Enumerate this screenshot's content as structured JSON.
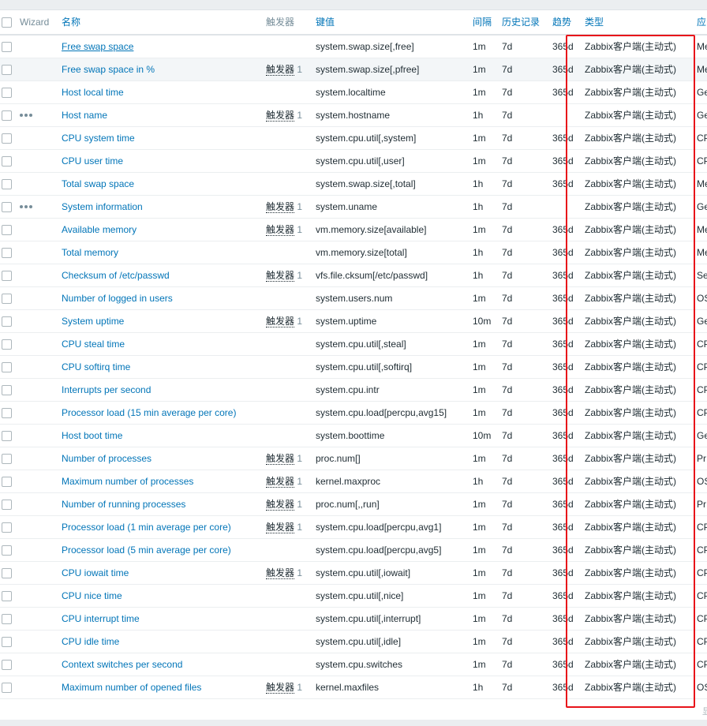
{
  "headers": {
    "wizard": "Wizard",
    "name": "名称",
    "triggers": "触发器",
    "key": "键值",
    "interval": "间隔",
    "history": "历史记录",
    "trends": "趋势",
    "type": "类型",
    "applications": "应"
  },
  "footer": {
    "text": "显"
  },
  "highlight_color": "#e8141a",
  "rows": [
    {
      "name": "Free swap space",
      "triggers": "",
      "trig_count": "",
      "key": "system.swap.size[,free]",
      "interval": "1m",
      "history": "7d",
      "trends": "365d",
      "type": "Zabbix客户端(主动式)",
      "app": "Me"
    },
    {
      "name": "Free swap space in %",
      "triggers": "触发器",
      "trig_count": "1",
      "key": "system.swap.size[,pfree]",
      "interval": "1m",
      "history": "7d",
      "trends": "365d",
      "type": "Zabbix客户端(主动式)",
      "app": "Me"
    },
    {
      "name": "Host local time",
      "triggers": "",
      "trig_count": "",
      "key": "system.localtime",
      "interval": "1m",
      "history": "7d",
      "trends": "365d",
      "type": "Zabbix客户端(主动式)",
      "app": "Ge"
    },
    {
      "name": "Host name",
      "triggers": "触发器",
      "trig_count": "1",
      "key": "system.hostname",
      "interval": "1h",
      "history": "7d",
      "trends": "",
      "type": "Zabbix客户端(主动式)",
      "app": "Ge"
    },
    {
      "name": "CPU system time",
      "triggers": "",
      "trig_count": "",
      "key": "system.cpu.util[,system]",
      "interval": "1m",
      "history": "7d",
      "trends": "365d",
      "type": "Zabbix客户端(主动式)",
      "app": "CP"
    },
    {
      "name": "CPU user time",
      "triggers": "",
      "trig_count": "",
      "key": "system.cpu.util[,user]",
      "interval": "1m",
      "history": "7d",
      "trends": "365d",
      "type": "Zabbix客户端(主动式)",
      "app": "CP"
    },
    {
      "name": "Total swap space",
      "triggers": "",
      "trig_count": "",
      "key": "system.swap.size[,total]",
      "interval": "1h",
      "history": "7d",
      "trends": "365d",
      "type": "Zabbix客户端(主动式)",
      "app": "Me"
    },
    {
      "name": "System information",
      "triggers": "触发器",
      "trig_count": "1",
      "key": "system.uname",
      "interval": "1h",
      "history": "7d",
      "trends": "",
      "type": "Zabbix客户端(主动式)",
      "app": "Ge"
    },
    {
      "name": "Available memory",
      "triggers": "触发器",
      "trig_count": "1",
      "key": "vm.memory.size[available]",
      "interval": "1m",
      "history": "7d",
      "trends": "365d",
      "type": "Zabbix客户端(主动式)",
      "app": "Me"
    },
    {
      "name": "Total memory",
      "triggers": "",
      "trig_count": "",
      "key": "vm.memory.size[total]",
      "interval": "1h",
      "history": "7d",
      "trends": "365d",
      "type": "Zabbix客户端(主动式)",
      "app": "Me"
    },
    {
      "name": "Checksum of /etc/passwd",
      "triggers": "触发器",
      "trig_count": "1",
      "key": "vfs.file.cksum[/etc/passwd]",
      "interval": "1h",
      "history": "7d",
      "trends": "365d",
      "type": "Zabbix客户端(主动式)",
      "app": "Se"
    },
    {
      "name": "Number of logged in users",
      "triggers": "",
      "trig_count": "",
      "key": "system.users.num",
      "interval": "1m",
      "history": "7d",
      "trends": "365d",
      "type": "Zabbix客户端(主动式)",
      "app": "OS"
    },
    {
      "name": "System uptime",
      "triggers": "触发器",
      "trig_count": "1",
      "key": "system.uptime",
      "interval": "10m",
      "history": "7d",
      "trends": "365d",
      "type": "Zabbix客户端(主动式)",
      "app": "Ge"
    },
    {
      "name": "CPU steal time",
      "triggers": "",
      "trig_count": "",
      "key": "system.cpu.util[,steal]",
      "interval": "1m",
      "history": "7d",
      "trends": "365d",
      "type": "Zabbix客户端(主动式)",
      "app": "CP"
    },
    {
      "name": "CPU softirq time",
      "triggers": "",
      "trig_count": "",
      "key": "system.cpu.util[,softirq]",
      "interval": "1m",
      "history": "7d",
      "trends": "365d",
      "type": "Zabbix客户端(主动式)",
      "app": "CP"
    },
    {
      "name": "Interrupts per second",
      "triggers": "",
      "trig_count": "",
      "key": "system.cpu.intr",
      "interval": "1m",
      "history": "7d",
      "trends": "365d",
      "type": "Zabbix客户端(主动式)",
      "app": "CP"
    },
    {
      "name": "Processor load (15 min average per core)",
      "triggers": "",
      "trig_count": "",
      "key": "system.cpu.load[percpu,avg15]",
      "interval": "1m",
      "history": "7d",
      "trends": "365d",
      "type": "Zabbix客户端(主动式)",
      "app": "CP"
    },
    {
      "name": "Host boot time",
      "triggers": "",
      "trig_count": "",
      "key": "system.boottime",
      "interval": "10m",
      "history": "7d",
      "trends": "365d",
      "type": "Zabbix客户端(主动式)",
      "app": "Ge"
    },
    {
      "name": "Number of processes",
      "triggers": "触发器",
      "trig_count": "1",
      "key": "proc.num[]",
      "interval": "1m",
      "history": "7d",
      "trends": "365d",
      "type": "Zabbix客户端(主动式)",
      "app": "Pr"
    },
    {
      "name": "Maximum number of processes",
      "triggers": "触发器",
      "trig_count": "1",
      "key": "kernel.maxproc",
      "interval": "1h",
      "history": "7d",
      "trends": "365d",
      "type": "Zabbix客户端(主动式)",
      "app": "OS"
    },
    {
      "name": "Number of running processes",
      "triggers": "触发器",
      "trig_count": "1",
      "key": "proc.num[,,run]",
      "interval": "1m",
      "history": "7d",
      "trends": "365d",
      "type": "Zabbix客户端(主动式)",
      "app": "Pr"
    },
    {
      "name": "Processor load (1 min average per core)",
      "triggers": "触发器",
      "trig_count": "1",
      "key": "system.cpu.load[percpu,avg1]",
      "interval": "1m",
      "history": "7d",
      "trends": "365d",
      "type": "Zabbix客户端(主动式)",
      "app": "CP"
    },
    {
      "name": "Processor load (5 min average per core)",
      "triggers": "",
      "trig_count": "",
      "key": "system.cpu.load[percpu,avg5]",
      "interval": "1m",
      "history": "7d",
      "trends": "365d",
      "type": "Zabbix客户端(主动式)",
      "app": "CP"
    },
    {
      "name": "CPU iowait time",
      "triggers": "触发器",
      "trig_count": "1",
      "key": "system.cpu.util[,iowait]",
      "interval": "1m",
      "history": "7d",
      "trends": "365d",
      "type": "Zabbix客户端(主动式)",
      "app": "CP"
    },
    {
      "name": "CPU nice time",
      "triggers": "",
      "trig_count": "",
      "key": "system.cpu.util[,nice]",
      "interval": "1m",
      "history": "7d",
      "trends": "365d",
      "type": "Zabbix客户端(主动式)",
      "app": "CP"
    },
    {
      "name": "CPU interrupt time",
      "triggers": "",
      "trig_count": "",
      "key": "system.cpu.util[,interrupt]",
      "interval": "1m",
      "history": "7d",
      "trends": "365d",
      "type": "Zabbix客户端(主动式)",
      "app": "CP"
    },
    {
      "name": "CPU idle time",
      "triggers": "",
      "trig_count": "",
      "key": "system.cpu.util[,idle]",
      "interval": "1m",
      "history": "7d",
      "trends": "365d",
      "type": "Zabbix客户端(主动式)",
      "app": "CP"
    },
    {
      "name": "Context switches per second",
      "triggers": "",
      "trig_count": "",
      "key": "system.cpu.switches",
      "interval": "1m",
      "history": "7d",
      "trends": "365d",
      "type": "Zabbix客户端(主动式)",
      "app": "CP"
    },
    {
      "name": "Maximum number of opened files",
      "triggers": "触发器",
      "trig_count": "1",
      "key": "kernel.maxfiles",
      "interval": "1h",
      "history": "7d",
      "trends": "365d",
      "type": "Zabbix客户端(主动式)",
      "app": "OS"
    }
  ]
}
